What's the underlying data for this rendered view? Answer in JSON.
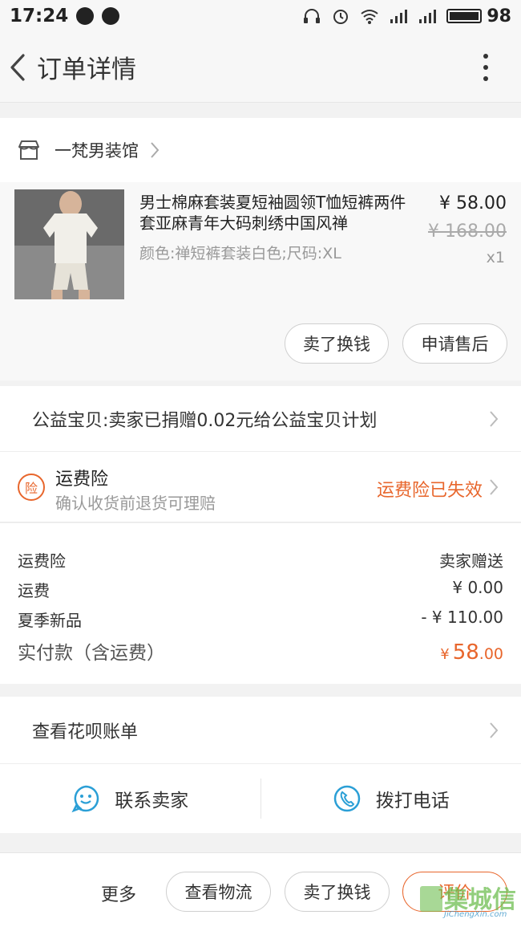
{
  "status_bar": {
    "time": "17:24",
    "battery": "98",
    "battery_level": 0.98
  },
  "nav": {
    "title": "订单详情"
  },
  "shop": {
    "name": "一梵男装馆"
  },
  "product": {
    "title": "男士棉麻套装夏短袖圆领T恤短裤两件套亚麻青年大码刺绣中国风禅",
    "sku": "颜色:禅短裤套装白色;尺码:XL",
    "price_now": "¥ 58.00",
    "price_old": "¥ 168.00",
    "quantity": "x1",
    "sell_button": "卖了换钱",
    "aftersale_button": "申请售后"
  },
  "charity": {
    "text": "公益宝贝:卖家已捐赠0.02元给公益宝贝计划"
  },
  "insurance": {
    "badge": "险",
    "title": "运费险",
    "subtitle": "确认收货前退货可理赔",
    "status": "运费险已失效",
    "status_color": "#e8662c"
  },
  "summary": {
    "rows": [
      {
        "label": "运费险",
        "value": "卖家赠送"
      },
      {
        "label": "运费",
        "value": "¥ 0.00"
      },
      {
        "label": "夏季新品",
        "value": "- ¥ 110.00"
      }
    ],
    "total_label": "实付款（含运费）",
    "total_currency": "¥",
    "total_int": "58",
    "total_dec": ".00"
  },
  "huabei": {
    "text": "查看花呗账单"
  },
  "contact": {
    "seller": "联系卖家",
    "call": "拨打电话"
  },
  "bottom_bar": {
    "more": "更多",
    "logistics": "查看物流",
    "sell": "卖了换钱",
    "review": "评价"
  },
  "watermark": {
    "text": "集城信",
    "sub": "JiChengXin.com"
  }
}
